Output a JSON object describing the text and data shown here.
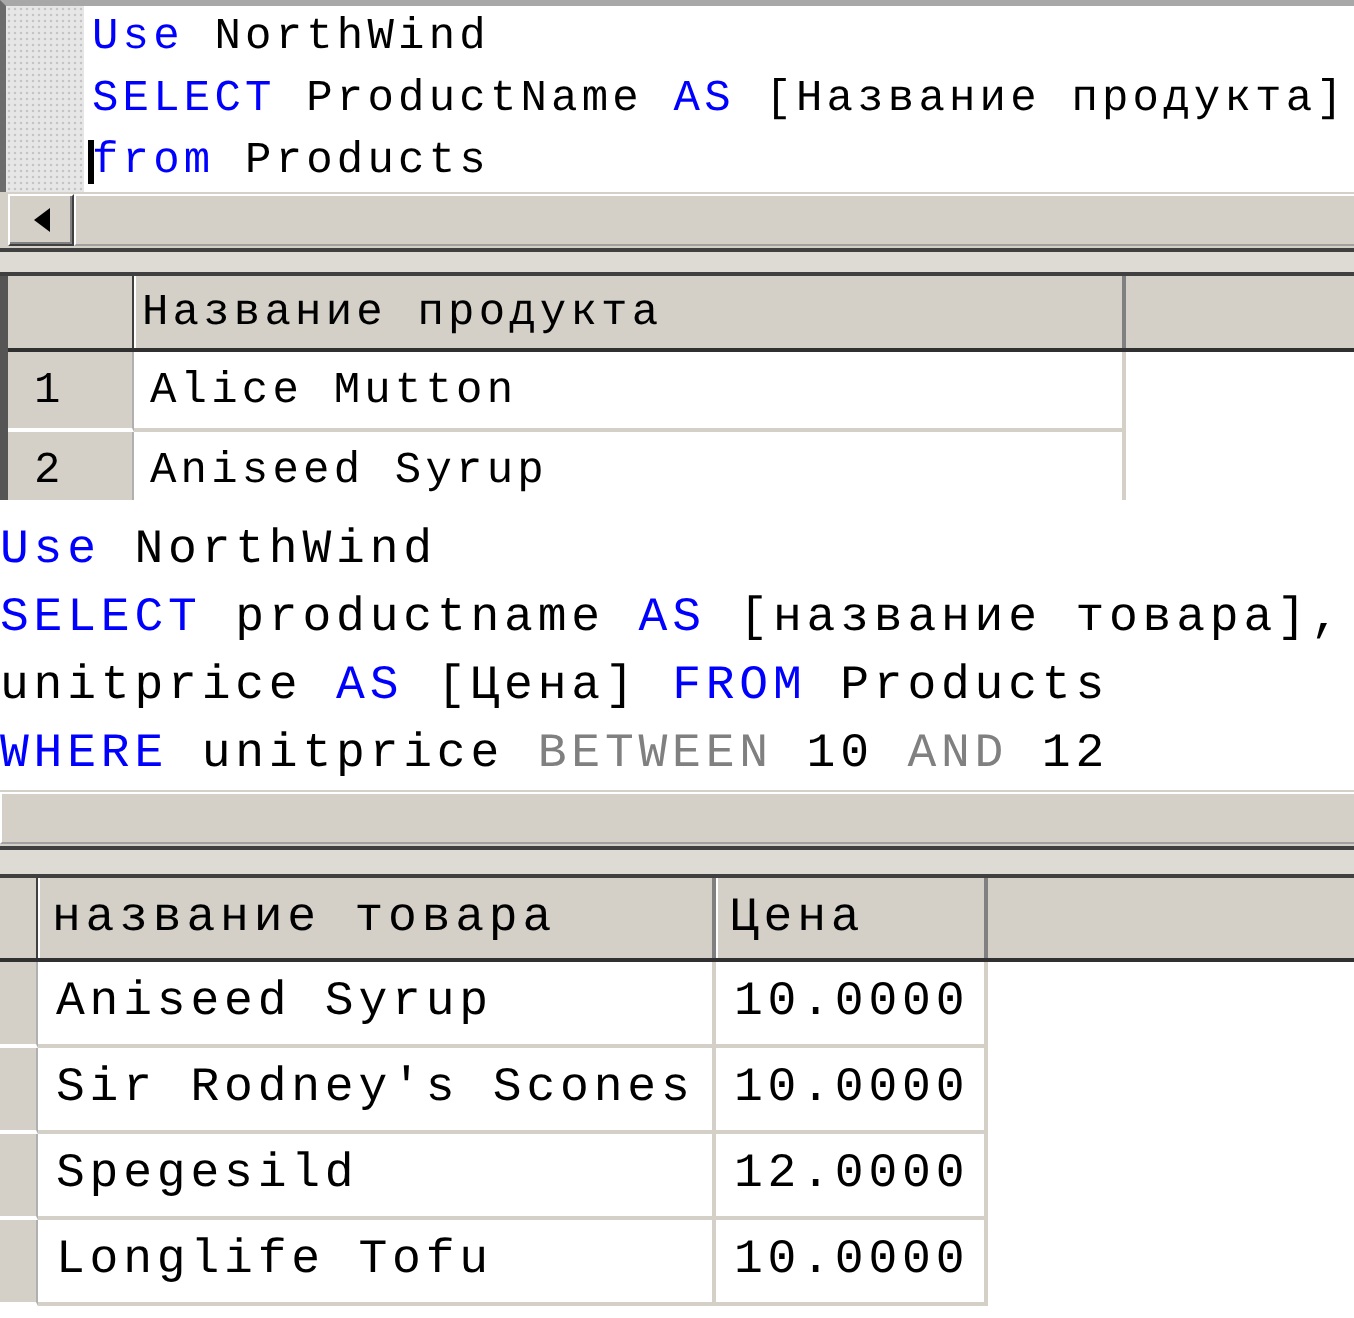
{
  "panels": [
    {
      "editor": {
        "gutter": true,
        "lines": [
          {
            "caret": false,
            "tokens": [
              {
                "kind": "keyword",
                "text": "Use"
              },
              {
                "kind": "plain",
                "text": " NorthWind"
              }
            ]
          },
          {
            "caret": false,
            "tokens": [
              {
                "kind": "keyword",
                "text": "SELECT"
              },
              {
                "kind": "plain",
                "text": " ProductName "
              },
              {
                "kind": "keyword",
                "text": "AS"
              },
              {
                "kind": "plain",
                "text": " [Название продукта]"
              }
            ]
          },
          {
            "caret": true,
            "tokens": [
              {
                "kind": "keyword",
                "text": "from"
              },
              {
                "kind": "plain",
                "text": " Products"
              }
            ]
          }
        ]
      },
      "results": {
        "columns": [
          "Название продукта"
        ],
        "rows": [
          {
            "number": "1",
            "cells": [
              "Alice Mutton"
            ]
          },
          {
            "number": "2",
            "cells": [
              "Aniseed Syrup"
            ]
          }
        ]
      }
    },
    {
      "editor": {
        "gutter": false,
        "lines": [
          {
            "caret": false,
            "tokens": [
              {
                "kind": "keyword",
                "text": "Use"
              },
              {
                "kind": "plain",
                "text": " NorthWind"
              }
            ]
          },
          {
            "caret": false,
            "tokens": [
              {
                "kind": "keyword",
                "text": "SELECT"
              },
              {
                "kind": "plain",
                "text": " productname "
              },
              {
                "kind": "keyword",
                "text": "AS"
              },
              {
                "kind": "plain",
                "text": " [название товара],"
              }
            ]
          },
          {
            "caret": false,
            "tokens": [
              {
                "kind": "plain",
                "text": "unitprice "
              },
              {
                "kind": "keyword",
                "text": "AS"
              },
              {
                "kind": "plain",
                "text": " [Цена] "
              },
              {
                "kind": "keyword",
                "text": "FROM"
              },
              {
                "kind": "plain",
                "text": " Products"
              }
            ]
          },
          {
            "caret": false,
            "tokens": [
              {
                "kind": "keyword",
                "text": "WHERE"
              },
              {
                "kind": "plain",
                "text": " unitprice "
              },
              {
                "kind": "operator",
                "text": "BETWEEN"
              },
              {
                "kind": "plain",
                "text": " 10 "
              },
              {
                "kind": "operator",
                "text": "AND"
              },
              {
                "kind": "plain",
                "text": " 12"
              }
            ]
          }
        ]
      },
      "results": {
        "columns": [
          "название товара",
          "Цена"
        ],
        "rows": [
          {
            "cells": [
              "Aniseed Syrup",
              "10.0000"
            ]
          },
          {
            "cells": [
              "Sir Rodney's Scones",
              "10.0000"
            ]
          },
          {
            "cells": [
              "Spegesild",
              "12.0000"
            ]
          },
          {
            "cells": [
              "Longlife Tofu",
              "10.0000"
            ]
          }
        ]
      }
    }
  ]
}
